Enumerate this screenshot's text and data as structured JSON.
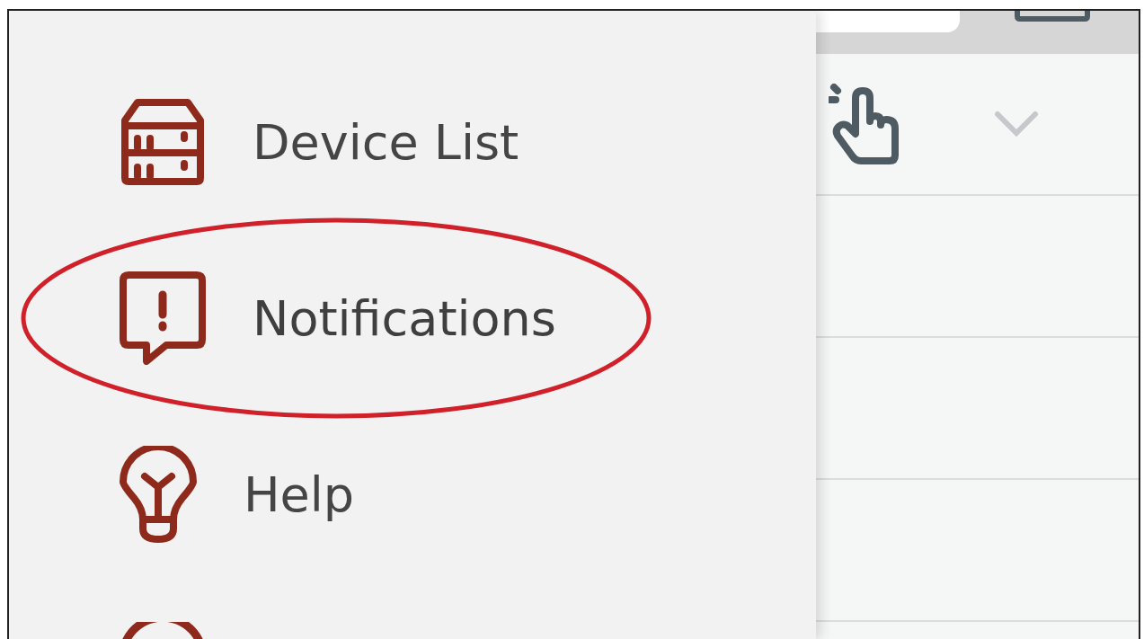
{
  "drawer": {
    "items": [
      {
        "kind": "server",
        "label": "Device List",
        "highlighted": false
      },
      {
        "kind": "alert",
        "label": "Notifications",
        "highlighted": true
      },
      {
        "kind": "help",
        "label": "Help",
        "highlighted": false
      },
      {
        "kind": "partial",
        "highlighted": false
      }
    ]
  },
  "panel": {
    "rows": [
      {
        "kind": "action"
      },
      {
        "kind": "empty"
      },
      {
        "kind": "empty"
      },
      {
        "kind": "empty"
      }
    ]
  }
}
